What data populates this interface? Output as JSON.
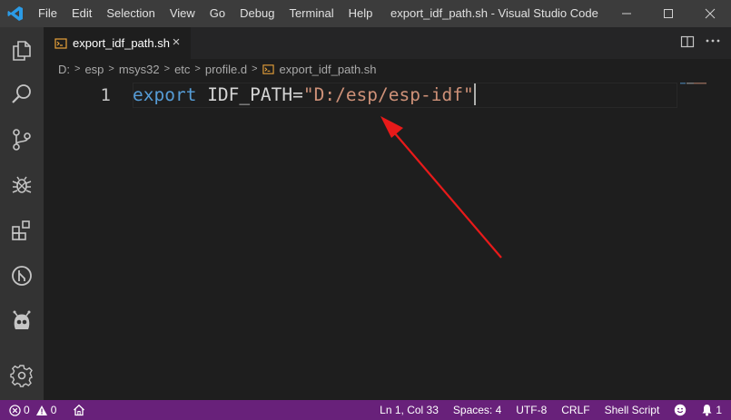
{
  "titlebar": {
    "menu": [
      "File",
      "Edit",
      "Selection",
      "View",
      "Go",
      "Debug",
      "Terminal",
      "Help"
    ],
    "window_title": "export_idf_path.sh - Visual Studio Code"
  },
  "activity_bar": {
    "icons": [
      "explorer-icon",
      "search-icon",
      "source-control-icon",
      "debug-icon",
      "extensions-icon",
      "git-history-icon",
      "platformio-icon",
      "settings-gear-icon"
    ]
  },
  "tab": {
    "label": "export_idf_path.sh",
    "close_glyph": "×"
  },
  "breadcrumb": {
    "parts": [
      "D:",
      "esp",
      "msys32",
      "etc",
      "profile.d",
      "export_idf_path.sh"
    ]
  },
  "editor": {
    "line_number": "1",
    "keyword": "export",
    "variable": " IDF_PATH=",
    "string": "\"D:/esp/esp-idf\""
  },
  "statusbar": {
    "errors": "0",
    "warnings": "0",
    "position": "Ln 1, Col 33",
    "spaces": "Spaces: 4",
    "encoding": "UTF-8",
    "eol": "CRLF",
    "language": "Shell Script",
    "notifications": "1"
  },
  "colors": {
    "statusbar_bg": "#68217a",
    "keyword": "#569cd6",
    "string": "#ce9178",
    "arrow": "#e81a1a",
    "vscode_logo": "#2b9be6"
  }
}
